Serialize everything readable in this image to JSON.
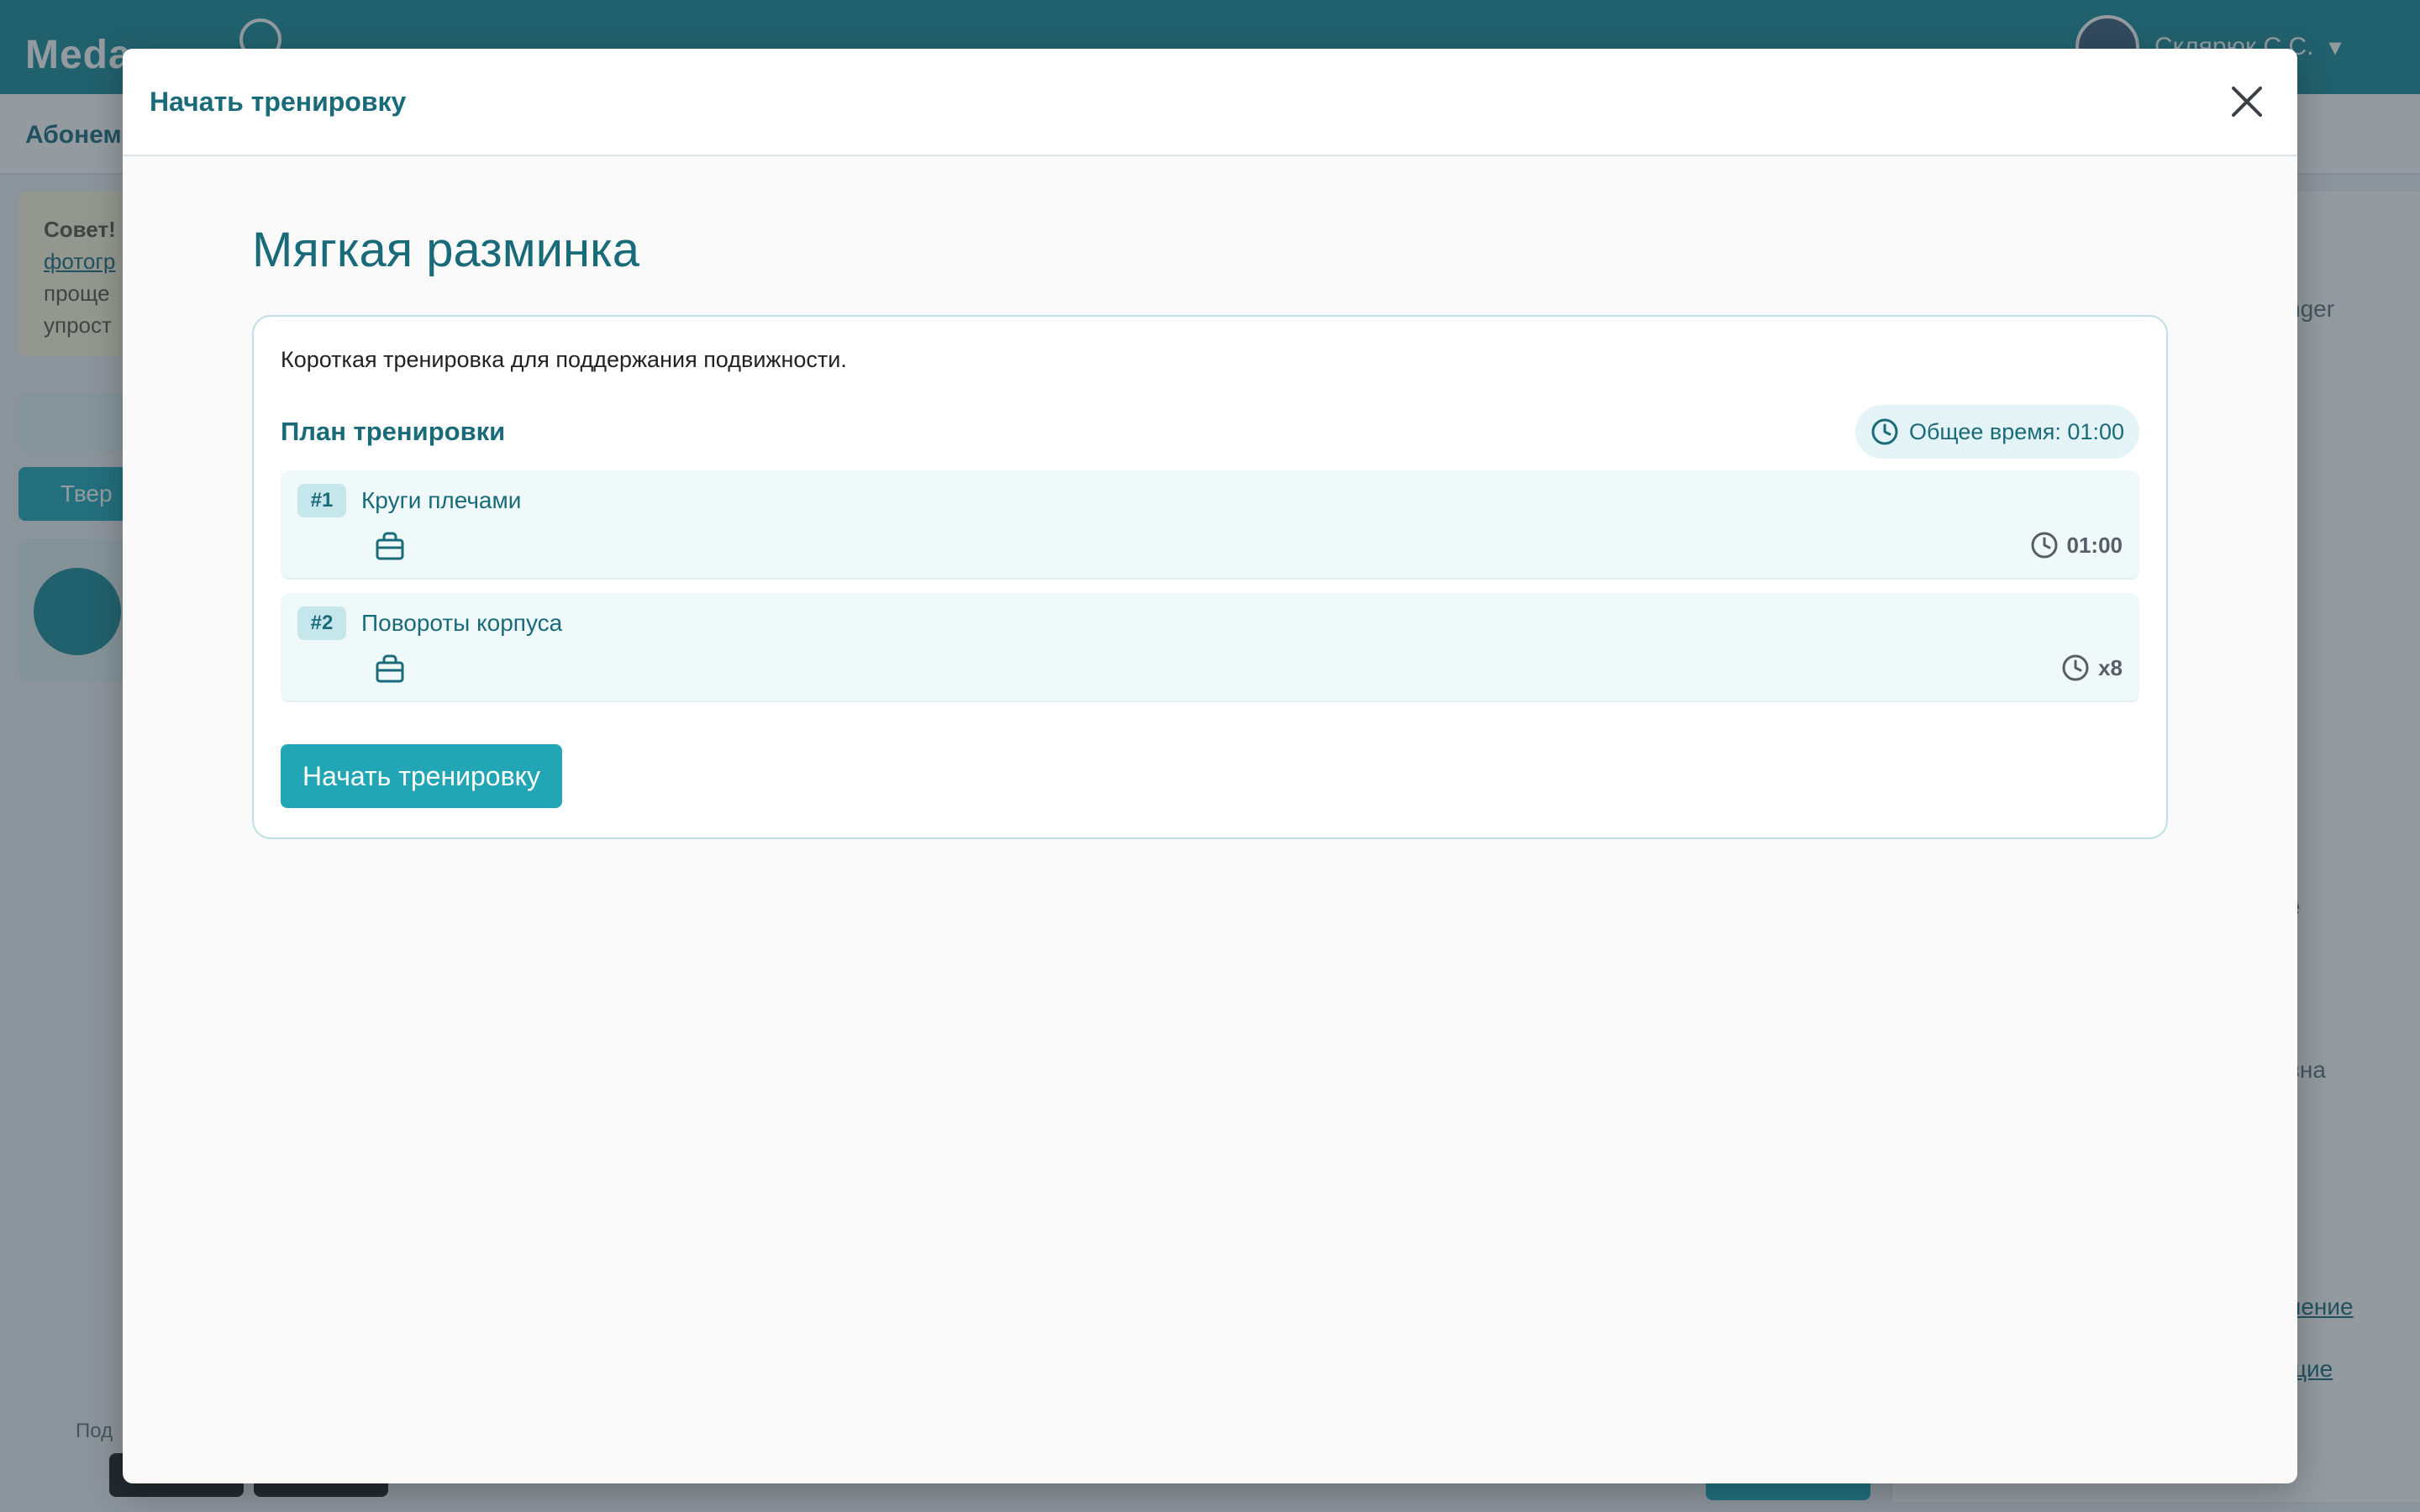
{
  "background": {
    "logo": "Meda",
    "user_name": "Склярюк С.С.",
    "subnav_item": "Абонем",
    "tip_prefix": "Совет!",
    "tip_link": "фотогр",
    "tip_line2": "проще",
    "tip_line3": "упрост",
    "button_label": "Твер",
    "right_text_1": "nger",
    "right_text_2": "е",
    "right_text_3": "вна",
    "right_link_1": "ление",
    "right_link_2": "щие",
    "footer_text": "Под"
  },
  "modal": {
    "header_title": "Начать тренировку",
    "workout_title": "Мягкая разминка",
    "description": "Короткая тренировка для поддержания подвижности.",
    "plan_title": "План тренировки",
    "total_time": "Общее время: 01:00",
    "exercises": [
      {
        "number": "#1",
        "name": "Круги плечами",
        "duration": "01:00",
        "equipment_icon": "bag-icon",
        "duration_icon": "clock-icon"
      },
      {
        "number": "#2",
        "name": "Повороты корпуса",
        "duration": "x8",
        "equipment_icon": "bag-icon",
        "duration_icon": "clock-icon"
      }
    ],
    "start_button": "Начать тренировку"
  },
  "colors": {
    "primary": "#22a6b5",
    "heading": "#1a6b7a",
    "header_bg": "#1a8a99"
  }
}
